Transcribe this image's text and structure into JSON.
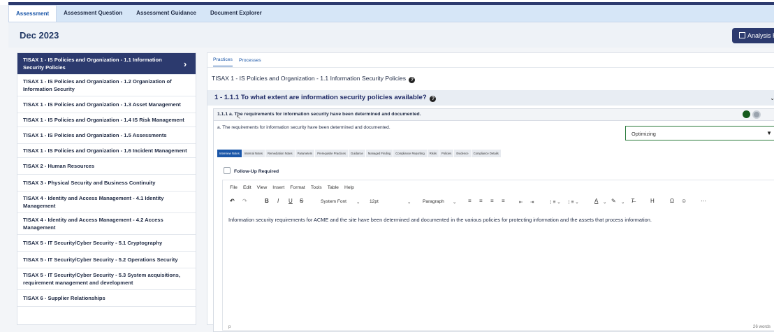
{
  "tabs": [
    "Assessment",
    "Assessment Question",
    "Assessment Guidance",
    "Document Explorer"
  ],
  "header": {
    "title": "Dec 2023",
    "report_button": "Analysis Repo"
  },
  "sidebar": {
    "items": [
      {
        "label": "TISAX 1 - IS Policies and Organization - 1.1 Information Security Policies",
        "active": true
      },
      {
        "label": "TISAX 1 - IS Policies and Organization - 1.2 Organization of Information Security"
      },
      {
        "label": "TISAX 1 - IS Policies and Organization - 1.3 Asset Management"
      },
      {
        "label": "TISAX 1 - IS Policies and Organization - 1.4 IS Risk Management"
      },
      {
        "label": "TISAX 1 - IS Policies and Organization - 1.5 Assessments"
      },
      {
        "label": "TISAX 1 - IS Policies and Organization - 1.6 Incident Management"
      },
      {
        "label": "TISAX 2 - Human Resources"
      },
      {
        "label": "TISAX 3 - Physical Security and Business Continuity"
      },
      {
        "label": "TISAX 4 - Identity and Access Management - 4.1 Identity Management"
      },
      {
        "label": "TISAX 4 - Identity and Access Management - 4.2 Access Management"
      },
      {
        "label": "TISAX 5 - IT Security/Cyber Security - 5.1 Cryptography"
      },
      {
        "label": "TISAX 5 - IT Security/Cyber Security - 5.2 Operations Security"
      },
      {
        "label": "TISAX 5 - IT Security/Cyber Security - 5.3 System acquisitions, requirement management and development"
      },
      {
        "label": "TISAX 6 - Supplier Relationships"
      }
    ]
  },
  "panel": {
    "subtabs": [
      "Practices",
      "Processes"
    ],
    "practice_title": "TISAX 1 - IS Policies and Organization - 1.1 Information Security Policies",
    "question": "1 - 1.1.1 To what extent are information security policies available?",
    "requirement_title": "1.1.1  a. The requirements for information security have been determined and documented.",
    "requirement_text": "a. The requirements for information security have been determined and documented.",
    "maturity_value": "Optimizing",
    "note_tabs": [
      "Interview Notes",
      "Internal Notes",
      "Remediation Notes",
      "Parameters",
      "Prerequisite Practices",
      "Guidance",
      "Managed Finding",
      "Compliance Reporting",
      "Risks",
      "Policies",
      "Evidence",
      "Compliance Details"
    ],
    "followup_label": "Follow-Up Required",
    "editor": {
      "menu": [
        "File",
        "Edit",
        "View",
        "Insert",
        "Format",
        "Tools",
        "Table",
        "Help"
      ],
      "font_family": "System Font",
      "font_size": "12pt",
      "block_format": "Paragraph",
      "content": "Information security requirements for ACME and the site have been determined and documented in the various policies for protecting information and the assets that process information.",
      "status_path": "p",
      "word_count": "26 words"
    }
  },
  "colors": {
    "navy": "#2c3a6e",
    "accent": "#1a56a8",
    "green": "#155a1c"
  }
}
